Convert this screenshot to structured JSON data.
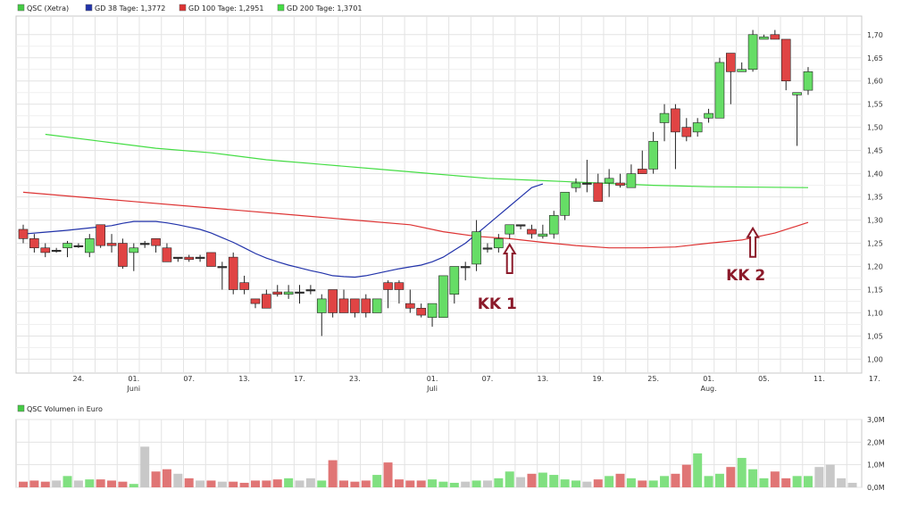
{
  "colors": {
    "up": "#66dd66",
    "down": "#e04444",
    "neutral": "#c8c8c8",
    "vol_up": "#80e080",
    "vol_down": "#e07575",
    "ma38": "#2233aa",
    "ma100": "#dd3333",
    "ma200": "#44dd44",
    "grid": "#e3e3e3",
    "annotation": "#8b1a2a"
  },
  "legend": [
    {
      "label": "QSC (Xetra)",
      "swatch": "#44cc44"
    },
    {
      "label": "GD 38 Tage: 1,3772",
      "swatch": "#2233aa"
    },
    {
      "label": "GD 100 Tage: 1,2951",
      "swatch": "#dd3333"
    },
    {
      "label": "GD 200 Tage: 1,3701",
      "swatch": "#44dd44"
    }
  ],
  "volume_legend": {
    "label": "QSC Volumen in Euro",
    "swatch": "#44cc44"
  },
  "annotations": [
    {
      "label": "KK 1",
      "x": 44,
      "y": 1.255
    },
    {
      "label": "KK 2",
      "x": 66,
      "y": 1.29
    }
  ],
  "chart_data": [
    {
      "type": "candlestick",
      "x_labels": [
        {
          "i": 5,
          "label": "24."
        },
        {
          "i": 10,
          "label": "01.",
          "sub": "Juni"
        },
        {
          "i": 15,
          "label": "07."
        },
        {
          "i": 20,
          "label": "13."
        },
        {
          "i": 25,
          "label": "17."
        },
        {
          "i": 30,
          "label": "23."
        },
        {
          "i": 37,
          "label": "01.",
          "sub": "Juli"
        },
        {
          "i": 42,
          "label": "07."
        },
        {
          "i": 47,
          "label": "13."
        },
        {
          "i": 52,
          "label": "19."
        },
        {
          "i": 57,
          "label": "25."
        },
        {
          "i": 62,
          "label": "01.",
          "sub": "Aug."
        },
        {
          "i": 67,
          "label": "05."
        },
        {
          "i": 72,
          "label": "11."
        },
        {
          "i": 77,
          "label": "17."
        }
      ],
      "y_ticks": [
        "1,00",
        "1,05",
        "1,10",
        "1,15",
        "1,20",
        "1,25",
        "1,30",
        "1,35",
        "1,40",
        "1,45",
        "1,50",
        "1,55",
        "1,60",
        "1,65",
        "1,70"
      ],
      "ylim": [
        0.97,
        1.74
      ],
      "ohlc": [
        [
          1.28,
          1.29,
          1.25,
          1.26
        ],
        [
          1.26,
          1.27,
          1.23,
          1.24
        ],
        [
          1.24,
          1.25,
          1.22,
          1.23
        ],
        [
          1.235,
          1.24,
          1.23,
          1.235
        ],
        [
          1.24,
          1.255,
          1.22,
          1.25
        ],
        [
          1.245,
          1.25,
          1.24,
          1.245
        ],
        [
          1.23,
          1.27,
          1.22,
          1.26
        ],
        [
          1.29,
          1.29,
          1.24,
          1.245
        ],
        [
          1.25,
          1.27,
          1.23,
          1.245
        ],
        [
          1.25,
          1.26,
          1.195,
          1.2
        ],
        [
          1.23,
          1.25,
          1.19,
          1.24
        ],
        [
          1.25,
          1.255,
          1.24,
          1.25
        ],
        [
          1.26,
          1.26,
          1.23,
          1.245
        ],
        [
          1.24,
          1.25,
          1.21,
          1.21
        ],
        [
          1.22,
          1.22,
          1.21,
          1.22
        ],
        [
          1.22,
          1.225,
          1.21,
          1.215
        ],
        [
          1.22,
          1.225,
          1.21,
          1.22
        ],
        [
          1.23,
          1.23,
          1.2,
          1.2
        ],
        [
          1.2,
          1.21,
          1.15,
          1.2
        ],
        [
          1.22,
          1.23,
          1.14,
          1.15
        ],
        [
          1.165,
          1.18,
          1.14,
          1.15
        ],
        [
          1.13,
          1.13,
          1.11,
          1.12
        ],
        [
          1.14,
          1.15,
          1.11,
          1.11
        ],
        [
          1.145,
          1.16,
          1.135,
          1.14
        ],
        [
          1.14,
          1.16,
          1.13,
          1.145
        ],
        [
          1.145,
          1.16,
          1.12,
          1.145
        ],
        [
          1.15,
          1.16,
          1.14,
          1.15
        ],
        [
          1.1,
          1.14,
          1.05,
          1.13
        ],
        [
          1.15,
          1.15,
          1.09,
          1.1
        ],
        [
          1.13,
          1.15,
          1.1,
          1.1
        ],
        [
          1.13,
          1.13,
          1.09,
          1.1
        ],
        [
          1.13,
          1.14,
          1.09,
          1.1
        ],
        [
          1.1,
          1.13,
          1.1,
          1.13
        ],
        [
          1.165,
          1.17,
          1.11,
          1.15
        ],
        [
          1.165,
          1.17,
          1.12,
          1.15
        ],
        [
          1.12,
          1.15,
          1.1,
          1.11
        ],
        [
          1.11,
          1.12,
          1.09,
          1.095
        ],
        [
          1.09,
          1.11,
          1.07,
          1.12
        ],
        [
          1.09,
          1.17,
          1.09,
          1.18
        ],
        [
          1.14,
          1.2,
          1.12,
          1.2
        ],
        [
          1.2,
          1.21,
          1.17,
          1.2
        ],
        [
          1.205,
          1.3,
          1.19,
          1.275
        ],
        [
          1.24,
          1.25,
          1.23,
          1.24
        ],
        [
          1.24,
          1.27,
          1.23,
          1.26
        ],
        [
          1.27,
          1.29,
          1.26,
          1.29
        ],
        [
          1.29,
          1.29,
          1.28,
          1.29
        ],
        [
          1.28,
          1.29,
          1.26,
          1.27
        ],
        [
          1.265,
          1.29,
          1.26,
          1.27
        ],
        [
          1.27,
          1.32,
          1.26,
          1.31
        ],
        [
          1.31,
          1.35,
          1.3,
          1.36
        ],
        [
          1.37,
          1.39,
          1.36,
          1.38
        ],
        [
          1.38,
          1.43,
          1.36,
          1.38
        ],
        [
          1.38,
          1.4,
          1.34,
          1.34
        ],
        [
          1.38,
          1.41,
          1.35,
          1.39
        ],
        [
          1.38,
          1.4,
          1.37,
          1.375
        ],
        [
          1.37,
          1.42,
          1.37,
          1.4
        ],
        [
          1.41,
          1.45,
          1.4,
          1.4
        ],
        [
          1.41,
          1.49,
          1.4,
          1.47
        ],
        [
          1.51,
          1.55,
          1.47,
          1.53
        ],
        [
          1.54,
          1.55,
          1.41,
          1.49
        ],
        [
          1.5,
          1.52,
          1.47,
          1.48
        ],
        [
          1.49,
          1.52,
          1.48,
          1.51
        ],
        [
          1.52,
          1.54,
          1.51,
          1.53
        ],
        [
          1.52,
          1.65,
          1.52,
          1.64
        ],
        [
          1.66,
          1.66,
          1.55,
          1.62
        ],
        [
          1.62,
          1.64,
          1.62,
          1.625
        ],
        [
          1.625,
          1.71,
          1.62,
          1.7
        ],
        [
          1.69,
          1.7,
          1.69,
          1.695
        ],
        [
          1.7,
          1.71,
          1.69,
          1.69
        ],
        [
          1.69,
          1.69,
          1.58,
          1.6
        ],
        [
          1.57,
          1.57,
          1.46,
          1.575
        ],
        [
          1.58,
          1.63,
          1.57,
          1.62
        ]
      ],
      "ma38": [
        1.27,
        1.274,
        1.278,
        1.283,
        1.288,
        1.293,
        1.297,
        1.297,
        1.297,
        1.294,
        1.29,
        1.285,
        1.28,
        1.272,
        1.262,
        1.252,
        1.24,
        1.228,
        1.218,
        1.21,
        1.203,
        1.197,
        1.191,
        1.186,
        1.18,
        1.178,
        1.177,
        1.18,
        1.185,
        1.19,
        1.195,
        1.199,
        1.203,
        1.21,
        1.22,
        1.235,
        1.25,
        1.27,
        1.29,
        1.31,
        1.33,
        1.35,
        1.37,
        1.378
      ],
      "ma38_x": [
        0,
        2,
        4,
        6,
        8,
        9,
        10,
        11,
        12,
        13,
        14,
        15,
        16,
        17,
        18,
        19,
        20,
        21,
        22,
        23,
        24,
        25,
        26,
        27,
        28,
        29,
        30,
        31,
        32,
        33,
        34,
        35,
        36,
        37,
        38,
        39,
        40,
        41,
        42,
        43,
        44,
        45,
        46,
        47
      ],
      "ma100": [
        1.36,
        1.35,
        1.34,
        1.33,
        1.32,
        1.31,
        1.3,
        1.29,
        1.275,
        1.265,
        1.26,
        1.252,
        1.245,
        1.24,
        1.24,
        1.242,
        1.25,
        1.257,
        1.272,
        1.295
      ],
      "ma100_x": [
        0,
        5,
        10,
        15,
        20,
        25,
        30,
        35,
        38,
        41,
        44,
        47,
        50,
        53,
        56,
        59,
        62,
        65,
        68,
        71
      ],
      "ma200": [
        1.485,
        1.47,
        1.455,
        1.445,
        1.43,
        1.42,
        1.41,
        1.4,
        1.39,
        1.385,
        1.38,
        1.375,
        1.372,
        1.37
      ],
      "ma200_x": [
        2,
        7,
        12,
        17,
        22,
        27,
        32,
        37,
        42,
        47,
        52,
        57,
        62,
        71
      ]
    },
    {
      "type": "bar",
      "series_name": "QSC Volumen in Euro",
      "y_ticks": [
        "0,0M",
        "1,0M",
        "2,0M",
        "3,0M"
      ],
      "ylim": [
        0,
        3
      ],
      "values": [
        0.25,
        0.3,
        0.25,
        0.3,
        0.5,
        0.3,
        0.35,
        0.35,
        0.3,
        0.25,
        0.15,
        1.8,
        0.7,
        0.8,
        0.6,
        0.4,
        0.3,
        0.3,
        0.25,
        0.25,
        0.2,
        0.3,
        0.3,
        0.35,
        0.4,
        0.3,
        0.4,
        0.3,
        1.2,
        0.3,
        0.25,
        0.3,
        0.55,
        1.1,
        0.35,
        0.3,
        0.3,
        0.35,
        0.25,
        0.2,
        0.25,
        0.3,
        0.3,
        0.4,
        0.7,
        0.45,
        0.6,
        0.65,
        0.55,
        0.35,
        0.3,
        0.25,
        0.35,
        0.5,
        0.6,
        0.4,
        0.3,
        0.3,
        0.5,
        0.6,
        1.0,
        1.5,
        0.5,
        0.6,
        0.9,
        1.3,
        0.8,
        0.4,
        0.7,
        0.4,
        0.5,
        0.5,
        0.9,
        1.0,
        0.4,
        0.2
      ]
    }
  ]
}
